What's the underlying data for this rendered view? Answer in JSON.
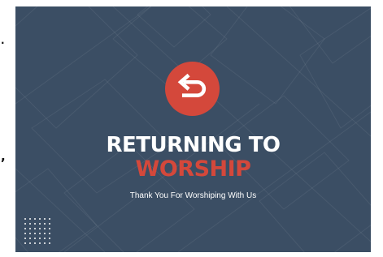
{
  "page": {
    "edge_marks": [
      ".",
      ","
    ]
  },
  "slide": {
    "background_color": "#3b4e64",
    "accent_color": "#d4483b",
    "icon": "return-arrow-icon",
    "title_line1": "RETURNING TO",
    "title_line2": "WORSHIP",
    "subtitle": "Thank You For Worshiping With Us"
  }
}
